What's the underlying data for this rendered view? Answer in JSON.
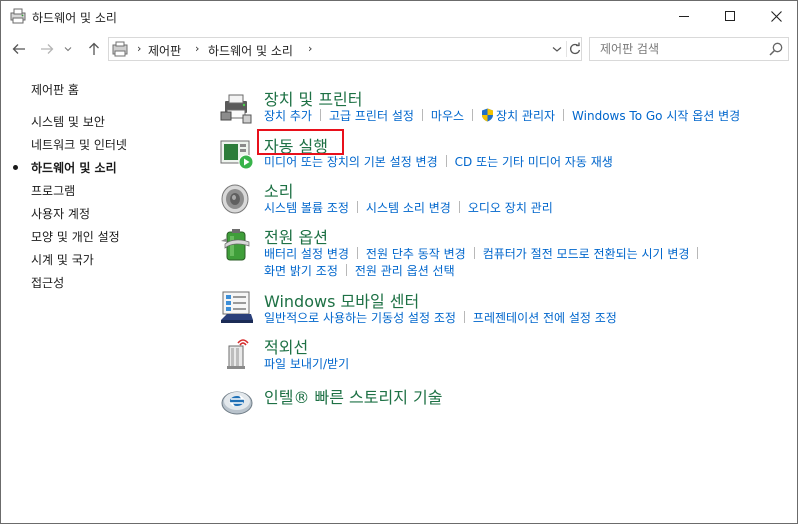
{
  "window": {
    "title": "하드웨어 및 소리"
  },
  "nav": {
    "breadcrumbs": [
      "제어판",
      "하드웨어 및 소리"
    ],
    "search_placeholder": "제어판 검색"
  },
  "sidebar": {
    "items": [
      {
        "label": "제어판 홈"
      },
      {
        "label": "시스템 및 보안"
      },
      {
        "label": "네트워크 및 인터넷"
      },
      {
        "label": "하드웨어 및 소리",
        "current": true
      },
      {
        "label": "프로그램"
      },
      {
        "label": "사용자 계정"
      },
      {
        "label": "모양 및 개인 설정"
      },
      {
        "label": "시계 및 국가"
      },
      {
        "label": "접근성"
      }
    ]
  },
  "categories": {
    "devices": {
      "title": "장치 및 프린터",
      "icon": "printer-icon",
      "links": [
        "장치 추가",
        "고급 프린터 설정",
        "마우스",
        "장치 관리자",
        "Windows To Go 시작 옵션 변경"
      ]
    },
    "autoplay": {
      "title": "자동 실행",
      "icon": "autoplay-icon",
      "highlight_color": "#e8101b",
      "links": [
        "미디어 또는 장치의 기본 설정 변경",
        "CD 또는 기타 미디어 자동 재생"
      ]
    },
    "sound": {
      "title": "소리",
      "icon": "speaker-icon",
      "links": [
        "시스템 볼륨 조정",
        "시스템 소리 변경",
        "오디오 장치 관리"
      ]
    },
    "power": {
      "title": "전원 옵션",
      "icon": "battery-icon",
      "links": [
        "배터리 설정 변경",
        "전원 단추 동작 변경",
        "컴퓨터가 절전 모드로 전환되는 시기 변경",
        "화면 밝기 조정",
        "전원 관리 옵션 선택"
      ]
    },
    "mobility": {
      "title": "Windows 모바일 센터",
      "icon": "mobility-center-icon",
      "links": [
        "일반적으로 사용하는 기동성 설정 조정",
        "프레젠테이션 전에 설정 조정"
      ]
    },
    "infrared": {
      "title": "적외선",
      "icon": "infrared-icon",
      "links": [
        "파일 보내기/받기"
      ]
    },
    "rst": {
      "title": "인텔® 빠른 스토리지 기술",
      "icon": "intel-rst-icon",
      "links": []
    }
  },
  "colors": {
    "title_green": "#1e7145",
    "link_blue": "#0066cc"
  }
}
